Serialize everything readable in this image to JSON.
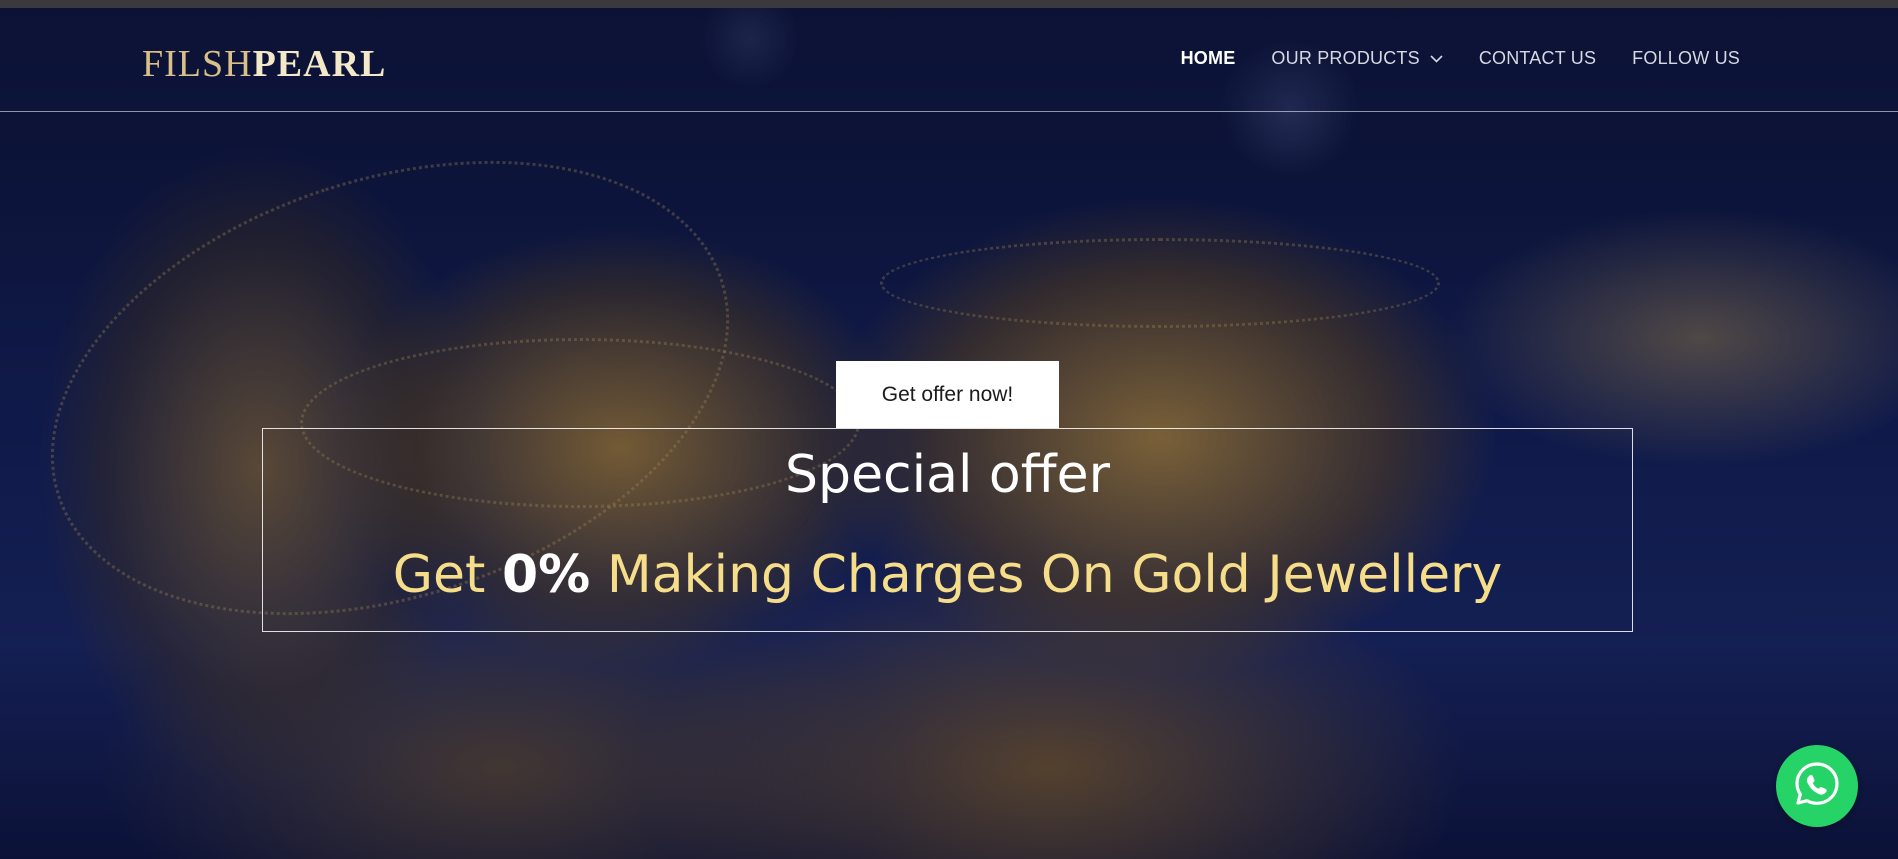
{
  "header": {
    "logo_part1": "FILSH",
    "logo_part2": "PEARL",
    "nav": [
      {
        "label": "HOME",
        "active": true
      },
      {
        "label": "OUR PRODUCTS",
        "active": false,
        "has_dropdown": true
      },
      {
        "label": "CONTACT US",
        "active": false
      },
      {
        "label": "FOLLOW US",
        "active": false
      }
    ]
  },
  "hero": {
    "cta_label": "Get offer now!",
    "offer_title": "Special offer",
    "offer_sub_prefix": "Get",
    "offer_sub_highlight": "0%",
    "offer_sub_suffix": "Making Charges On Gold Jewellery"
  },
  "floating": {
    "whatsapp_icon": "whatsapp-icon"
  },
  "colors": {
    "accent_gold": "#f5dd8a",
    "whatsapp_green": "#25d366"
  }
}
